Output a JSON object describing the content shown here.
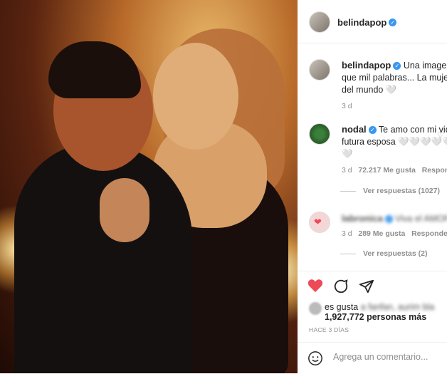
{
  "post": {
    "photo_alt": "",
    "header": {
      "username": "belindapop",
      "verified": true
    },
    "caption": {
      "username": "belindapop",
      "line1": "Una imagen d",
      "line2": "que mil palabras... La mujer",
      "line3": "del mundo 🤍",
      "time": "3 d"
    },
    "comments": [
      {
        "username": "nodal",
        "line1": "Te amo con mi vida",
        "line2": "futura esposa 🤍🤍🤍🤍🤍🤍🤍🤍🤍",
        "line3": "🤍",
        "time": "3 d",
        "likes": "72.217 Me gusta",
        "reply": "Responde",
        "view_replies": "Ver respuestas (1027)"
      },
      {
        "username": "labronica",
        "text": "Viva el AMOR!!!",
        "time": "3 d",
        "likes": "289 Me gusta",
        "reply": "Responder",
        "view_replies": "Ver respuestas (2)"
      }
    ],
    "likes_prefix": "es gusta",
    "likes_blurred": "a fanfan, aurim bla",
    "likes_count": "1,927,772 personas más",
    "time_ago": "HACE 3 DÍAS",
    "add_comment_placeholder": "Agrega un comentario...",
    "colors": {
      "like": "#ed4956",
      "verified": "#3897f0",
      "muted": "#8e8e8e"
    }
  }
}
